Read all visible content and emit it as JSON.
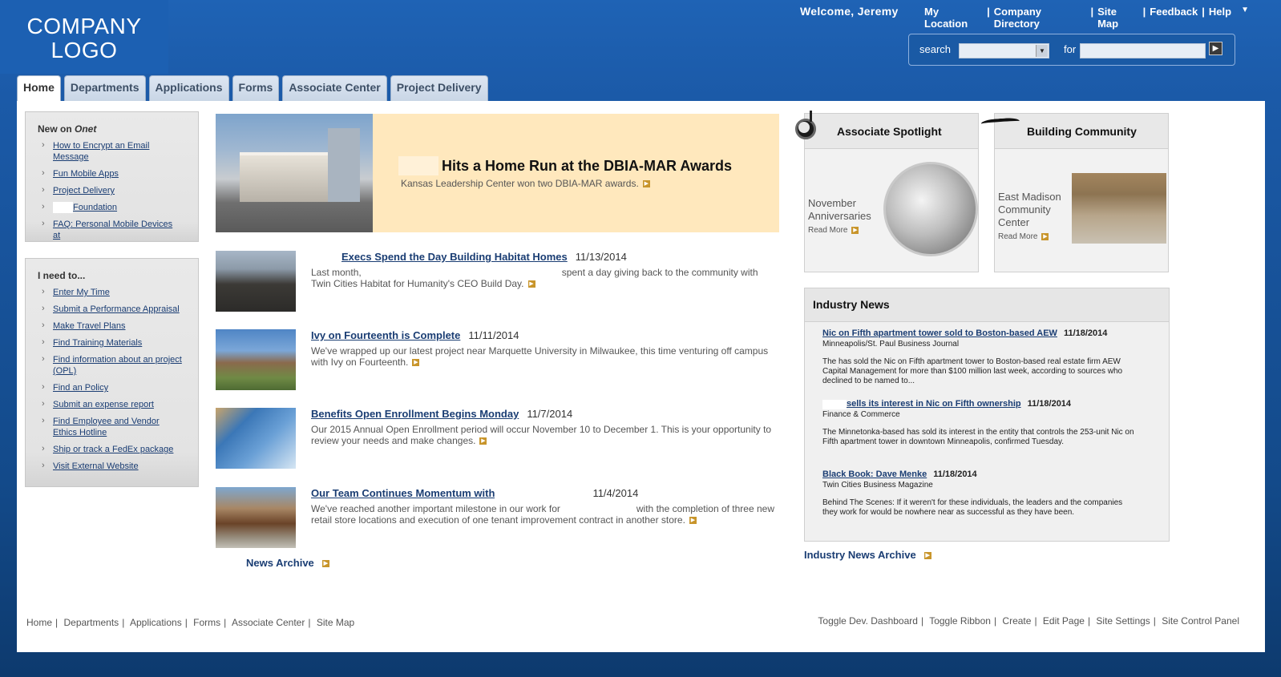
{
  "header": {
    "logo_line1": "COMPANY",
    "logo_line2": "LOGO",
    "welcome": "Welcome, Jeremy",
    "links": [
      "My Location",
      "Company Directory",
      "Site Map",
      "Feedback",
      "Help"
    ],
    "help_menu_icon": "chevron-down-icon"
  },
  "search": {
    "label": "search",
    "scope_value": "",
    "for_label": "for",
    "query_value": "",
    "go_icon": "arrow-right-icon"
  },
  "tabs": [
    "Home",
    "Departments",
    "Applications",
    "Forms",
    "Associate Center",
    "Project Delivery"
  ],
  "active_tab": "Home",
  "sidebar": {
    "new_on_title_prefix": "New on ",
    "new_on_title_name": "Onet",
    "new_on_items": [
      "How to Encrypt an Email Message",
      "Fun Mobile Apps",
      "Project Delivery",
      "Foundation",
      "FAQ: Personal Mobile Devices at"
    ],
    "ineed_title": "I need to...",
    "ineed_items": [
      "Enter My Time",
      "Submit a Performance Appraisal",
      "Make Travel Plans",
      "Find Training Materials",
      "Find information about an project (OPL)",
      "Find an Policy",
      "Submit an expense report",
      "Find Employee and Vendor Ethics Hotline",
      "Ship or track a FedEx package",
      "Visit External Website"
    ]
  },
  "feature": {
    "title": "Hits a Home Run at the DBIA-MAR Awards",
    "subtitle": "Kansas Leadership Center won two DBIA-MAR awards."
  },
  "news": [
    {
      "title": "Execs Spend the Day Building Habitat Homes",
      "date": "11/13/2014",
      "desc_a": "Last month,",
      "desc_b": "spent a day giving back to the community with Twin Cities Habitat for Humanity's CEO Build Day."
    },
    {
      "title": "Ivy on Fourteenth is Complete",
      "date": "11/11/2014",
      "desc_a": "We've wrapped up our latest project near Marquette University in Milwaukee, this time venturing off campus with Ivy on Fourteenth.",
      "desc_b": ""
    },
    {
      "title": "Benefits Open Enrollment Begins Monday",
      "date": "11/7/2014",
      "desc_a": "Our 2015 Annual Open Enrollment period will occur November 10 to December 1. This is your opportunity to review your needs and make changes.",
      "desc_b": ""
    },
    {
      "title": "Our Team Continues Momentum with",
      "date": "11/4/2014",
      "desc_a": "We've reached another important milestone in our work for",
      "desc_b": "with the completion of three new retail store locations and execution of one tenant improvement contract in another store."
    }
  ],
  "news_archive_label": "News Archive",
  "spotlight": {
    "title": "Associate Spotlight",
    "text": "November Anniversaries",
    "read_more": "Read More"
  },
  "community": {
    "title": "Building Community",
    "text": "East Madison Community Center",
    "read_more": "Read More"
  },
  "industry": {
    "title": "Industry News",
    "items": [
      {
        "title": "Nic on Fifth apartment tower sold to Boston-based AEW",
        "date": "11/18/2014",
        "source": "Minneapolis/St. Paul Business Journal",
        "body": "The has sold the Nic on Fifth apartment tower to Boston-based real estate firm AEW Capital Management for more than $100 million last week, according to sources who declined to be named to..."
      },
      {
        "title": "sells its interest in Nic on Fifth ownership",
        "date": "11/18/2014",
        "source": "Finance & Commerce",
        "body": "The Minnetonka-based has sold its interest in the entity that controls the 253-unit Nic on Fifth apartment tower in downtown Minneapolis, confirmed Tuesday."
      },
      {
        "title": "Black Book: Dave Menke",
        "date": "11/18/2014",
        "source": "Twin Cities Business Magazine",
        "body": "Behind The Scenes: If it weren't for these individuals, the leaders and the companies they work for would be nowhere near as successful as they have been."
      }
    ],
    "archive_label": "Industry News Archive"
  },
  "footer": {
    "left_links": [
      "Home",
      "Departments",
      "Applications",
      "Forms",
      "Associate Center",
      "Site Map"
    ],
    "right_links": [
      "Toggle Dev. Dashboard",
      "Toggle Ribbon",
      "Create",
      "Edit Page",
      "Site Settings",
      "Site Control Panel"
    ]
  },
  "colors": {
    "background": "#1b5aa8",
    "feature_bg": "#ffe8bd",
    "link": "#1a3d73",
    "arrow_badge": "#c8952b"
  }
}
